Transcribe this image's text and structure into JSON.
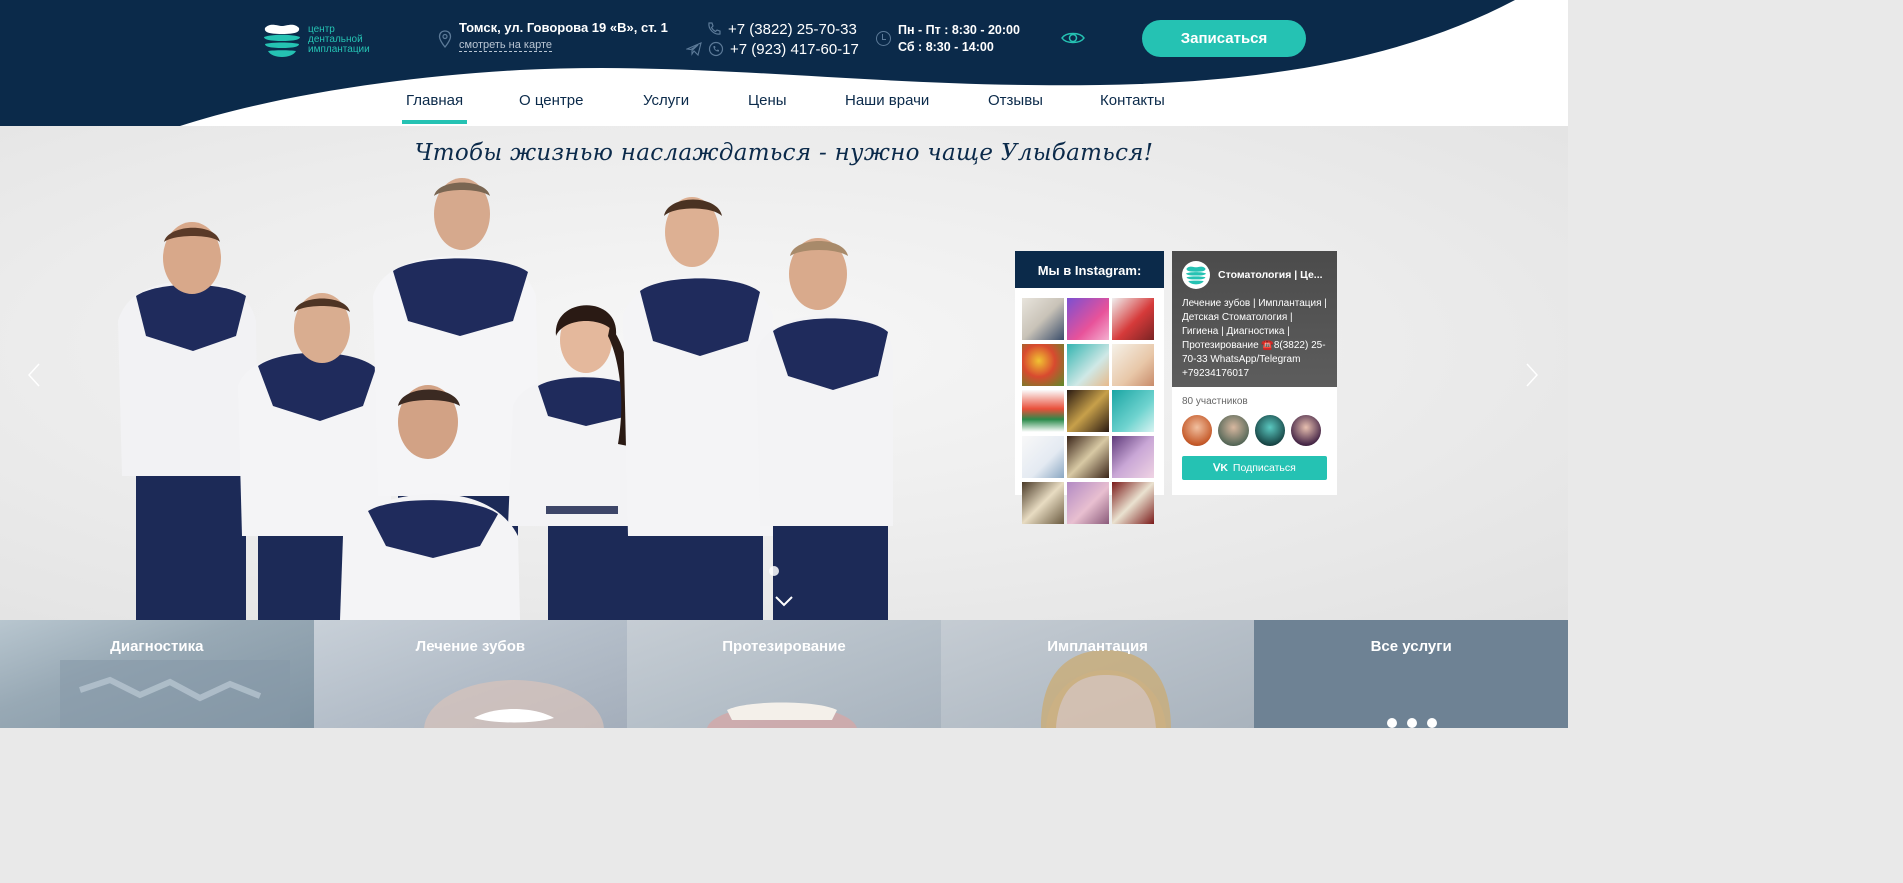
{
  "header": {
    "logo": {
      "line1": "центр",
      "line2": "дентальной",
      "line3": "имплантации"
    },
    "address": {
      "text": "Томск, ул. Говорова 19 «В», ст. 1",
      "map_link": "смотреть на карте"
    },
    "phones": [
      "+7 (3822) 25-70-33",
      "+7 (923) 417-60-17"
    ],
    "hours": [
      "Пн - Пт : 8:30 - 20:00",
      "Сб : 8:30 - 14:00"
    ],
    "cta_label": "Записаться",
    "colors": {
      "navy": "#0b2a4a",
      "accent": "#25c2b3"
    }
  },
  "nav": {
    "items": [
      {
        "label": "Главная",
        "active": true
      },
      {
        "label": "О центре"
      },
      {
        "label": "Услуги"
      },
      {
        "label": "Цены"
      },
      {
        "label": "Наши врачи"
      },
      {
        "label": "Отзывы"
      },
      {
        "label": "Контакты"
      }
    ]
  },
  "hero": {
    "slogan": "Чтобы жизнью наслаждаться - нужно чаще Улыбаться!"
  },
  "instagram": {
    "title": "Мы в Instagram:"
  },
  "vk": {
    "title": "Стоматология | Це...",
    "description": "Лечение зубов | Имплантация | Детская Стоматология | Гигиена | Диагностика | Протезирование ☎️8(3822) 25-70-33 WhatsApp/Telegram +79234176017",
    "members": "80 участников",
    "subscribe": "Подписаться"
  },
  "services": [
    {
      "label": "Диагностика"
    },
    {
      "label": "Лечение зубов"
    },
    {
      "label": "Протезирование"
    },
    {
      "label": "Имплантация"
    },
    {
      "label": "Все услуги"
    }
  ]
}
